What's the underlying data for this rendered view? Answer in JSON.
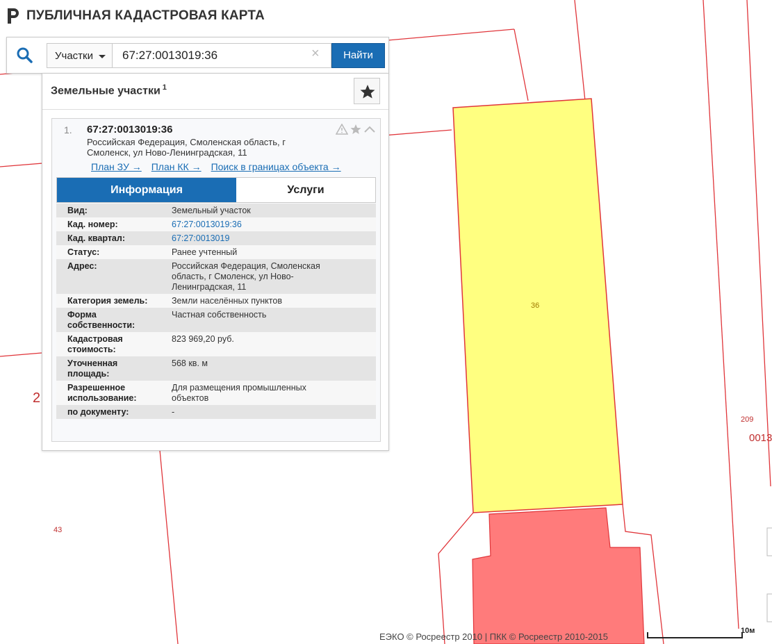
{
  "app": {
    "title": "ПУБЛИЧНАЯ КАДАСТРОВАЯ КАРТА"
  },
  "search": {
    "type_label": "Участки",
    "query": "67:27:0013019:36",
    "find_label": "Найти",
    "clear_label": "×"
  },
  "panel": {
    "title": "Земельные участки",
    "count": "1"
  },
  "result": {
    "index": "1.",
    "cadastral_number": "67:27:0013019:36",
    "address": "Российская Федерация, Смоленская область, г Смоленск, ул Ново-Ленинградская, 11",
    "links": [
      {
        "label": "План ЗУ →"
      },
      {
        "label": "План КК →"
      },
      {
        "label": "Поиск в границах объекта →"
      }
    ],
    "tabs": {
      "info": "Информация",
      "services": "Услуги"
    },
    "rows": [
      {
        "label": "Вид:",
        "value": "Земельный участок"
      },
      {
        "label": "Кад. номер:",
        "value": "67:27:0013019:36",
        "link": true
      },
      {
        "label": "Кад. квартал:",
        "value": "67:27:0013019",
        "link": true
      },
      {
        "label": "Статус:",
        "value": "Ранее учтенный"
      },
      {
        "label": "Адрес:",
        "value": "Российская Федерация, Смоленская область, г Смоленск, ул Ново-Ленинградская, 11"
      },
      {
        "label": "Категория земель:",
        "value": "Земли населённых пунктов"
      },
      {
        "label": "Форма собственности:",
        "value": "Частная собственность"
      },
      {
        "label": "Кадастровая стоимость:",
        "value": "823 969,20 руб."
      },
      {
        "label": "Уточненная площадь:",
        "value": "568 кв. м"
      },
      {
        "label": "Разрешенное использование:",
        "value": "Для размещения промышленных объектов"
      },
      {
        "label": "по документу:",
        "value": "-"
      }
    ]
  },
  "map": {
    "parcel_labels": [
      "36",
      "209",
      "0013",
      "43",
      "2"
    ],
    "scale_label": "10м",
    "footer": "ЕЭКО © Росреестр 2010 | ПКК © Росреестр 2010-2015",
    "colors": {
      "boundary": "#e0353a",
      "selected_parcel": "#ffff80",
      "building": "#ff7b7b",
      "accent": "#1a6db4"
    }
  },
  "icons": [
    "logo-icon",
    "search-icon",
    "chevron-down-icon",
    "clear-icon",
    "star-icon",
    "warning-icon",
    "chevron-up-icon"
  ]
}
